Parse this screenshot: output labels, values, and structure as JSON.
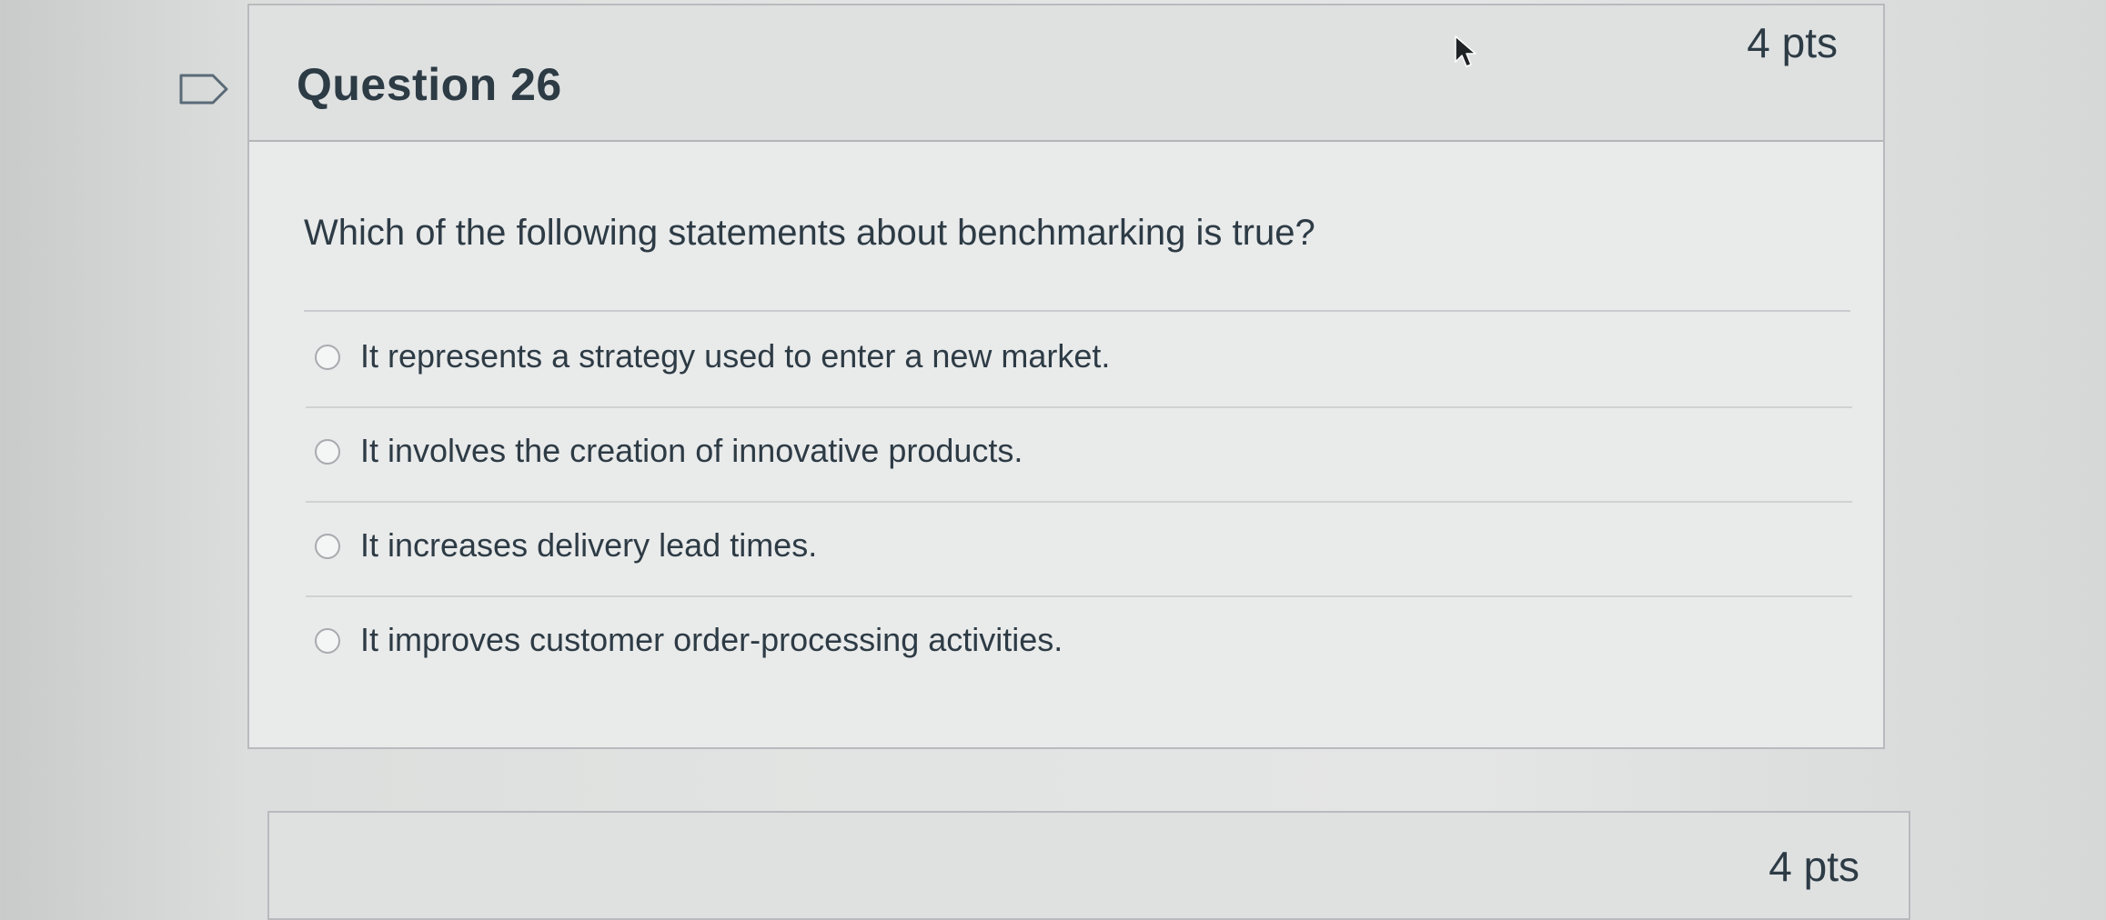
{
  "question": {
    "title": "Question 26",
    "points": "4 pts",
    "text": "Which of the following statements about benchmarking is true?",
    "answers": [
      {
        "label": "It represents a strategy used to enter a new market."
      },
      {
        "label": "It involves the creation of innovative products."
      },
      {
        "label": "It increases delivery lead times."
      },
      {
        "label": "It improves customer order-processing activities."
      }
    ]
  },
  "next_question": {
    "points": "4 pts"
  },
  "icons": {
    "flag": "flag-outline-icon",
    "cursor": "mouse-pointer-icon"
  }
}
